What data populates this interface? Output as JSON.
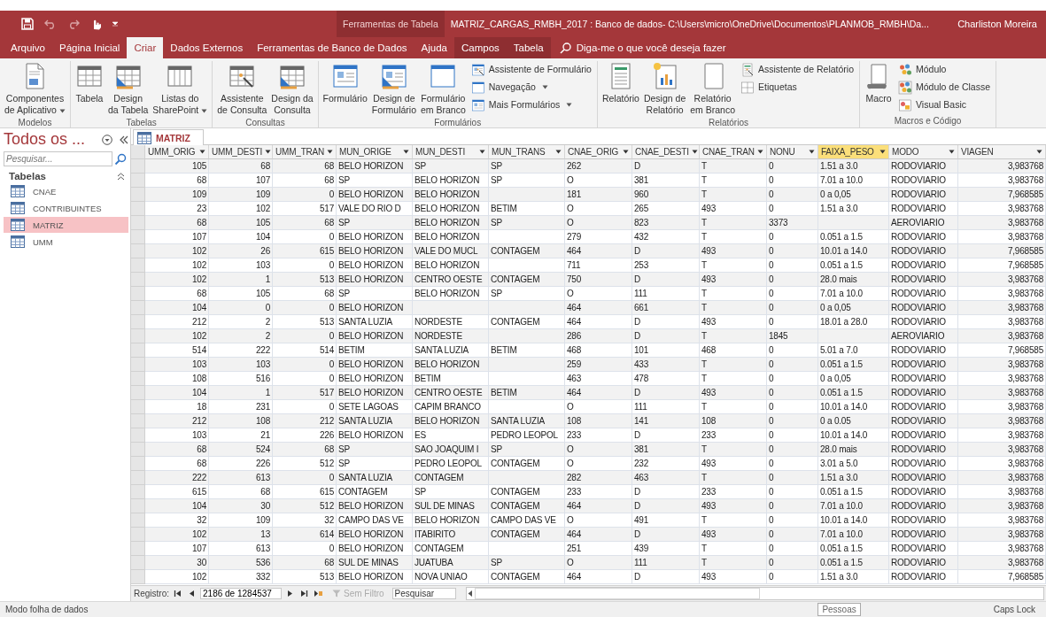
{
  "title_bar": {
    "context_label": "Ferramentas de Tabela",
    "title": "MATRIZ_CARGAS_RMBH_2017 : Banco de dados- C:\\Users\\micro\\OneDrive\\Documentos\\PLANMOB_RMBH\\Da...",
    "user": "Charliston Moreira"
  },
  "tabs": [
    {
      "label": "Arquivo",
      "selected": false,
      "kind": "normal"
    },
    {
      "label": "Página Inicial",
      "selected": false,
      "kind": "normal"
    },
    {
      "label": "Criar",
      "selected": true,
      "kind": "normal"
    },
    {
      "label": "Dados Externos",
      "selected": false,
      "kind": "normal"
    },
    {
      "label": "Ferramentas de Banco de Dados",
      "selected": false,
      "kind": "normal"
    },
    {
      "label": "Ajuda",
      "selected": false,
      "kind": "normal"
    },
    {
      "label": "Campos",
      "selected": false,
      "kind": "context"
    },
    {
      "label": "Tabela",
      "selected": false,
      "kind": "context"
    }
  ],
  "tell_me": {
    "placeholder": "Diga-me o que você deseja fazer"
  },
  "ribbon": {
    "groups": [
      {
        "label": "Modelos",
        "items": [
          {
            "kind": "large",
            "label": "Componentes\nde Aplicativo",
            "dropdown": true
          }
        ]
      },
      {
        "label": "Tabelas",
        "items": [
          {
            "kind": "large",
            "label": "Tabela",
            "dropdown": false
          },
          {
            "kind": "large",
            "label": "Design\nda Tabela",
            "dropdown": false
          },
          {
            "kind": "large",
            "label": "Listas do\nSharePoint",
            "dropdown": true
          }
        ]
      },
      {
        "label": "Consultas",
        "items": [
          {
            "kind": "large",
            "label": "Assistente\nde Consulta",
            "dropdown": false
          },
          {
            "kind": "large",
            "label": "Design da\nConsulta",
            "dropdown": false
          }
        ]
      },
      {
        "label": "Formulários",
        "items": [
          {
            "kind": "large",
            "label": "Formulário",
            "dropdown": false
          },
          {
            "kind": "large",
            "label": "Design de\nFormulário",
            "dropdown": false
          },
          {
            "kind": "large",
            "label": "Formulário\nem Branco",
            "dropdown": false
          },
          {
            "kind": "small",
            "label": "Assistente de Formulário",
            "dropdown": false
          },
          {
            "kind": "small",
            "label": "Navegação",
            "dropdown": true
          },
          {
            "kind": "small",
            "label": "Mais Formulários",
            "dropdown": true
          }
        ]
      },
      {
        "label": "Relatórios",
        "items": [
          {
            "kind": "large",
            "label": "Relatório",
            "dropdown": false
          },
          {
            "kind": "large",
            "label": "Design de\nRelatório",
            "dropdown": false
          },
          {
            "kind": "large",
            "label": "Relatório\nem Branco",
            "dropdown": false
          },
          {
            "kind": "small",
            "label": "Assistente de Relatório",
            "dropdown": false
          },
          {
            "kind": "small",
            "label": "Etiquetas",
            "dropdown": false
          }
        ]
      },
      {
        "label": "Macros e Código",
        "items": [
          {
            "kind": "large",
            "label": "Macro",
            "dropdown": false
          },
          {
            "kind": "small",
            "label": "Módulo",
            "dropdown": false
          },
          {
            "kind": "small",
            "label": "Módulo de Classe",
            "dropdown": false
          },
          {
            "kind": "small",
            "label": "Visual Basic",
            "dropdown": false
          }
        ]
      }
    ]
  },
  "nav_pane": {
    "title": "Todos os ...",
    "search": {
      "placeholder": "Pesquisar..."
    },
    "groups": [
      {
        "label": "Tabelas",
        "expanded": true,
        "items": [
          {
            "label": "CNAE",
            "selected": false
          },
          {
            "label": "CONTRIBUINTES",
            "selected": false
          },
          {
            "label": "MATRIZ",
            "selected": true
          },
          {
            "label": "UMM",
            "selected": false
          }
        ]
      }
    ]
  },
  "document_tabs": [
    {
      "label": "MATRIZ",
      "selected": true
    }
  ],
  "table": {
    "columns": [
      {
        "label": "UMM_ORIG",
        "kind": "number",
        "selected": false
      },
      {
        "label": "UMM_DESTI",
        "kind": "number",
        "selected": false
      },
      {
        "label": "UMM_TRAN",
        "kind": "number",
        "selected": false
      },
      {
        "label": "MUN_ORIGE",
        "kind": "text",
        "selected": false
      },
      {
        "label": "MUN_DESTI",
        "kind": "text",
        "selected": false
      },
      {
        "label": "MUN_TRANS",
        "kind": "text",
        "selected": false
      },
      {
        "label": "CNAE_ORIG",
        "kind": "text",
        "selected": false
      },
      {
        "label": "CNAE_DESTI",
        "kind": "text",
        "selected": false
      },
      {
        "label": "CNAE_TRAN",
        "kind": "text",
        "selected": false
      },
      {
        "label": "NONU",
        "kind": "text",
        "selected": false
      },
      {
        "label": "FAIXA_PESO",
        "kind": "text",
        "selected": true
      },
      {
        "label": "MODO",
        "kind": "text",
        "selected": false
      },
      {
        "label": "VIAGEN",
        "kind": "number",
        "selected": false
      }
    ],
    "rows": [
      [
        "105",
        "68",
        "68",
        "BELO HORIZON",
        "SP",
        "SP",
        "262",
        "D",
        "T",
        "0",
        "1.51 a 3.0",
        "RODOVIARIO",
        "3,983768"
      ],
      [
        "68",
        "107",
        "68",
        "SP",
        "BELO HORIZON",
        "SP",
        "O",
        "381",
        "T",
        "0",
        "7.01 a 10.0",
        "RODOVIARIO",
        "3,983768"
      ],
      [
        "109",
        "109",
        "0",
        "BELO HORIZON",
        "BELO HORIZON",
        null,
        "181",
        "960",
        "T",
        "0",
        "0 a 0,05",
        "RODOVIARIO",
        "7,968585"
      ],
      [
        "23",
        "102",
        "517",
        "VALE DO RIO D",
        "BELO HORIZON",
        "BETIM",
        "O",
        "265",
        "493",
        "0",
        "1.51 a 3.0",
        "RODOVIARIO",
        "3,983768"
      ],
      [
        "68",
        "105",
        "68",
        "SP",
        "BELO HORIZON",
        "SP",
        "O",
        "823",
        "T",
        "3373",
        null,
        "AEROVIARIO",
        "3,983768"
      ],
      [
        "107",
        "104",
        "0",
        "BELO HORIZON",
        "BELO HORIZON",
        null,
        "279",
        "432",
        "T",
        "0",
        "0.051 a 1.5",
        "RODOVIARIO",
        "3,983768"
      ],
      [
        "102",
        "26",
        "615",
        "BELO HORIZON",
        "VALE DO MUCL",
        "CONTAGEM",
        "464",
        "D",
        "493",
        "0",
        "10.01 a 14.0",
        "RODOVIARIO",
        "7,968585"
      ],
      [
        "102",
        "103",
        "0",
        "BELO HORIZON",
        "BELO HORIZON",
        null,
        "711",
        "253",
        "T",
        "0",
        "0.051 a 1.5",
        "RODOVIARIO",
        "7,968585"
      ],
      [
        "102",
        "1",
        "513",
        "BELO HORIZON",
        "CENTRO OESTE",
        "CONTAGEM",
        "750",
        "D",
        "493",
        "0",
        "28.0 mais",
        "RODOVIARIO",
        "3,983768"
      ],
      [
        "68",
        "105",
        "68",
        "SP",
        "BELO HORIZON",
        "SP",
        "O",
        "111",
        "T",
        "0",
        "7.01 a 10.0",
        "RODOVIARIO",
        "3,983768"
      ],
      [
        "104",
        "0",
        "0",
        "BELO HORIZON",
        null,
        null,
        "464",
        "661",
        "T",
        "0",
        "0 a 0,05",
        "RODOVIARIO",
        "3,983768"
      ],
      [
        "212",
        "2",
        "513",
        "SANTA LUZIA",
        "NORDESTE",
        "CONTAGEM",
        "464",
        "D",
        "493",
        "0",
        "18.01 a 28.0",
        "RODOVIARIO",
        "3,983768"
      ],
      [
        "102",
        "2",
        "0",
        "BELO HORIZON",
        "NORDESTE",
        null,
        "286",
        "D",
        "T",
        "1845",
        null,
        "AEROVIARIO",
        "3,983768"
      ],
      [
        "514",
        "222",
        "514",
        "BETIM",
        "SANTA LUZIA",
        "BETIM",
        "468",
        "101",
        "468",
        "0",
        "5.01 a 7.0",
        "RODOVIARIO",
        "7,968585"
      ],
      [
        "103",
        "103",
        "0",
        "BELO HORIZON",
        "BELO HORIZON",
        null,
        "259",
        "433",
        "T",
        "0",
        "0.051 a 1.5",
        "RODOVIARIO",
        "3,983768"
      ],
      [
        "108",
        "516",
        "0",
        "BELO HORIZON",
        "BETIM",
        null,
        "463",
        "478",
        "T",
        "0",
        "0 a 0,05",
        "RODOVIARIO",
        "3,983768"
      ],
      [
        "104",
        "1",
        "517",
        "BELO HORIZON",
        "CENTRO OESTE",
        "BETIM",
        "464",
        "D",
        "493",
        "0",
        "0.051 a 1.5",
        "RODOVIARIO",
        "3,983768"
      ],
      [
        "18",
        "231",
        "0",
        "SETE LAGOAS",
        "CAPIM BRANCO",
        null,
        "O",
        "111",
        "T",
        "0",
        "10.01 a 14.0",
        "RODOVIARIO",
        "3,983768"
      ],
      [
        "212",
        "108",
        "212",
        "SANTA LUZIA",
        "BELO HORIZON",
        "SANTA LUZIA",
        "108",
        "141",
        "108",
        "0",
        "0 a 0.05",
        "RODOVIARIO",
        "3,983768"
      ],
      [
        "103",
        "21",
        "226",
        "BELO HORIZON",
        "ES",
        "PEDRO LEOPOL",
        "233",
        "D",
        "233",
        "0",
        "10.01 a 14.0",
        "RODOVIARIO",
        "3,983768"
      ],
      [
        "68",
        "524",
        "68",
        "SP",
        "SAO JOAQUIM I",
        "SP",
        "O",
        "381",
        "T",
        "0",
        "28.0 mais",
        "RODOVIARIO",
        "3,983768"
      ],
      [
        "68",
        "226",
        "512",
        "SP",
        "PEDRO LEOPOL",
        "CONTAGEM",
        "O",
        "232",
        "493",
        "0",
        "3.01 a 5.0",
        "RODOVIARIO",
        "3,983768"
      ],
      [
        "222",
        "613",
        "0",
        "SANTA LUZIA",
        "CONTAGEM",
        null,
        "282",
        "463",
        "T",
        "0",
        "1.51 a 3.0",
        "RODOVIARIO",
        "3,983768"
      ],
      [
        "615",
        "68",
        "615",
        "CONTAGEM",
        "SP",
        "CONTAGEM",
        "233",
        "D",
        "233",
        "0",
        "0.051 a 1.5",
        "RODOVIARIO",
        "3,983768"
      ],
      [
        "104",
        "30",
        "512",
        "BELO HORIZON",
        "SUL DE MINAS",
        "CONTAGEM",
        "464",
        "D",
        "493",
        "0",
        "7.01 a 10.0",
        "RODOVIARIO",
        "3,983768"
      ],
      [
        "32",
        "109",
        "32",
        "CAMPO DAS VE",
        "BELO HORIZON",
        "CAMPO DAS VE",
        "O",
        "491",
        "T",
        "0",
        "10.01 a 14.0",
        "RODOVIARIO",
        "3,983768"
      ],
      [
        "102",
        "13",
        "614",
        "BELO HORIZON",
        "ITABIRITO",
        "CONTAGEM",
        "464",
        "D",
        "493",
        "0",
        "7.01 a 10.0",
        "RODOVIARIO",
        "3,983768"
      ],
      [
        "107",
        "613",
        "0",
        "BELO HORIZON",
        "CONTAGEM",
        null,
        "251",
        "439",
        "T",
        "0",
        "0.051 a 1.5",
        "RODOVIARIO",
        "3,983768"
      ],
      [
        "30",
        "536",
        "68",
        "SUL DE MINAS",
        "JUATUBA",
        "SP",
        "O",
        "111",
        "T",
        "0",
        "0.051 a 1.5",
        "RODOVIARIO",
        "3,983768"
      ],
      [
        "102",
        "332",
        "513",
        "BELO HORIZON",
        "NOVA UNIAO",
        "CONTAGEM",
        "464",
        "D",
        "493",
        "0",
        "1.51 a 3.0",
        "RODOVIARIO",
        "7,968585"
      ]
    ]
  },
  "record_nav": {
    "label": "Registro:",
    "position": "2186 de 1284537",
    "filter": {
      "label": "Sem Filtro",
      "disabled": true
    },
    "search": {
      "placeholder": "Pesquisar"
    }
  },
  "status_bar": {
    "mode": "Modo folha de dados",
    "people_button": "Pessoas",
    "caps_lock": "Caps Lock"
  }
}
